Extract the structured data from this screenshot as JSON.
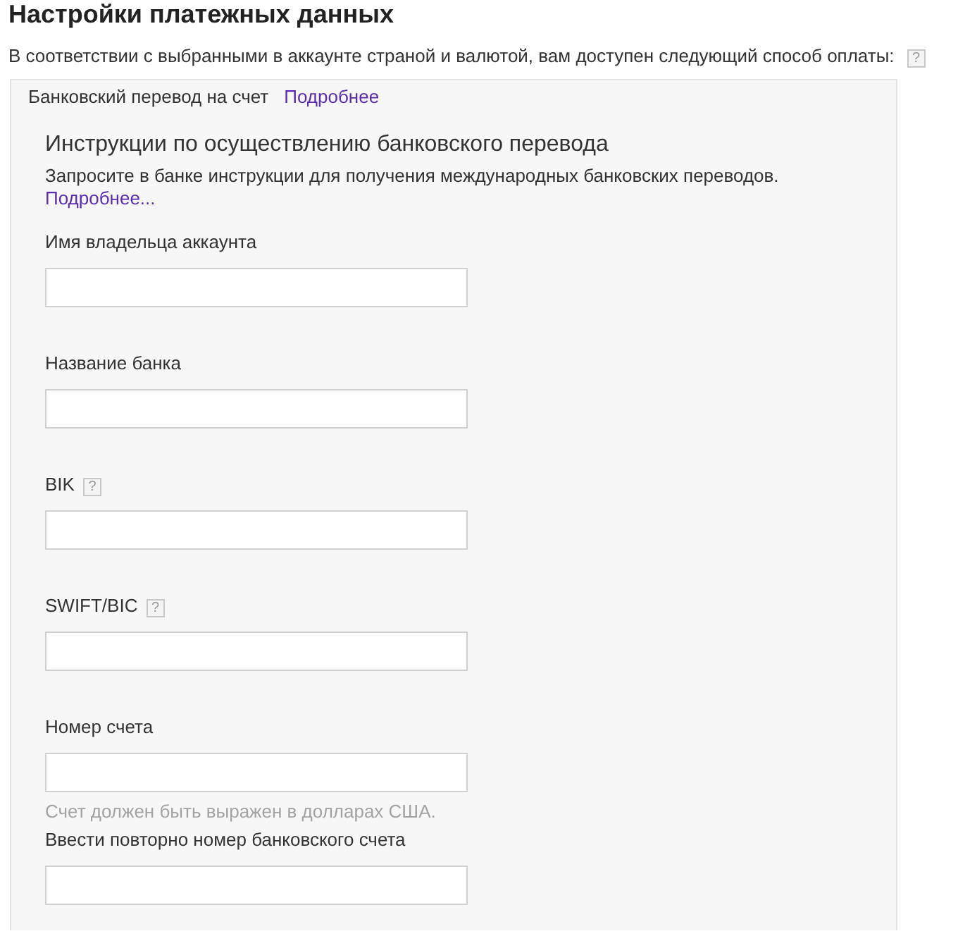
{
  "page": {
    "title": "Настройки платежных данных",
    "intro": "В соответствии с выбранными в аккаунте страной и валютой, вам доступен следующий способ оплаты:",
    "intro_help": "?"
  },
  "method": {
    "name": "Банковский перевод на счет",
    "link": "Подробнее"
  },
  "instructions": {
    "title": "Инструкции по осуществлению банковского перевода",
    "text": "Запросите в банке инструкции для получения международных банковских переводов.",
    "link": "Подробнее..."
  },
  "fields": [
    {
      "label": "Имя владельца аккаунта"
    },
    {
      "label": "Название банка"
    },
    {
      "label": "BIK",
      "help": "?"
    },
    {
      "label": "SWIFT/BIC",
      "help": "?"
    },
    {
      "label": "Номер счета",
      "hint": "Счет должен быть выражен в долларах США."
    },
    {
      "label": "Ввести повторно номер банковского счета"
    }
  ]
}
